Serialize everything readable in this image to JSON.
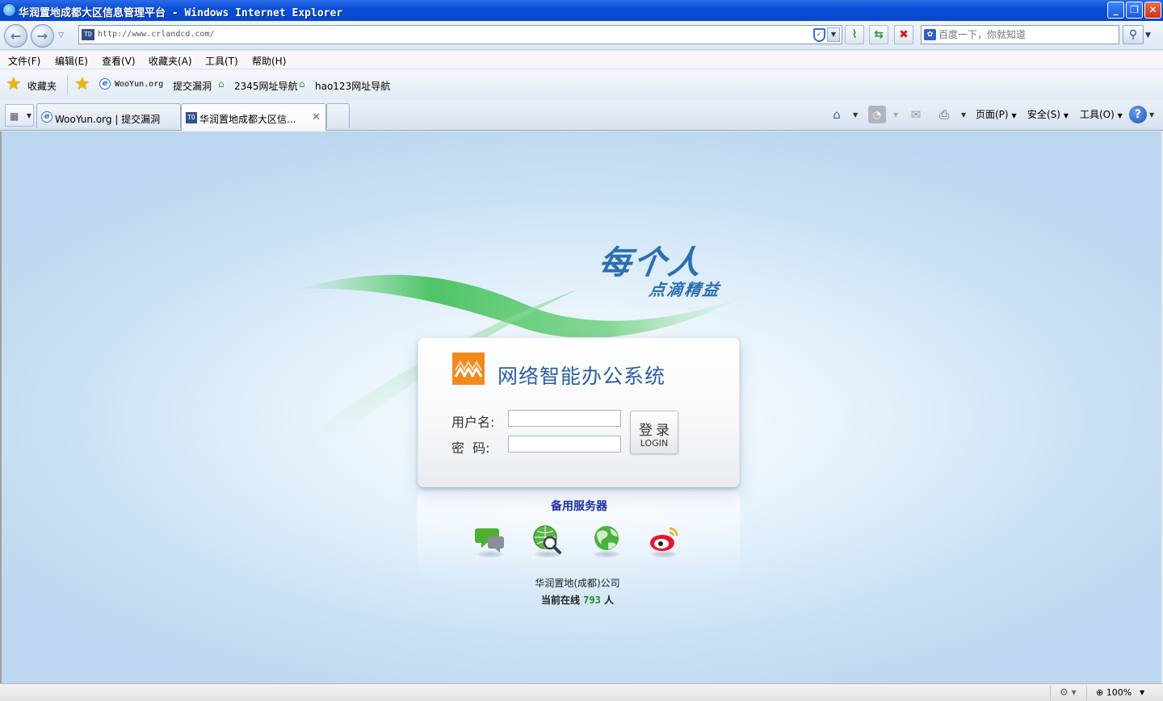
{
  "window": {
    "title": "华润置地成都大区信息管理平台 - Windows Internet Explorer",
    "buttons": {
      "minimize": "_",
      "restore": "❐",
      "close": "✕"
    }
  },
  "address": {
    "url": "http://www.crlandcd.com/",
    "favicon_text": "TD",
    "search_placeholder": "百度一下，你就知道"
  },
  "menu": [
    "文件(F)",
    "编辑(E)",
    "查看(V)",
    "收藏夹(A)",
    "工具(T)",
    "帮助(H)"
  ],
  "favorites": {
    "label": "收藏夹",
    "links": [
      "WooYun.org",
      "提交漏洞",
      "2345网址导航",
      "hao123网址导航"
    ]
  },
  "tabs": [
    {
      "label": "WooYun.org | 提交漏洞",
      "active": false
    },
    {
      "label": "华润置地成都大区信...",
      "active": true
    }
  ],
  "commands": {
    "page": "页面(P)",
    "safety": "安全(S)",
    "tools": "工具(O)"
  },
  "page": {
    "slogan_main": "每个人",
    "slogan_sub": "点滴精益",
    "system_title": "网络智能办公系统",
    "username_label": "用户名:",
    "password_label": "密  码:",
    "login_label_cn": "登录",
    "login_label_en": "LOGIN",
    "backup_server": "备用服务器",
    "company": "华润置地(成都)公司",
    "online_prefix": "当前在线",
    "online_count": "793",
    "online_suffix": "人"
  },
  "status": {
    "zoom": "100%"
  },
  "colors": {
    "accent": "#2c5f9e",
    "logo_orange": "#f28a1b",
    "link_blue": "#1a2fa0",
    "count_green": "#1f8a1f"
  }
}
